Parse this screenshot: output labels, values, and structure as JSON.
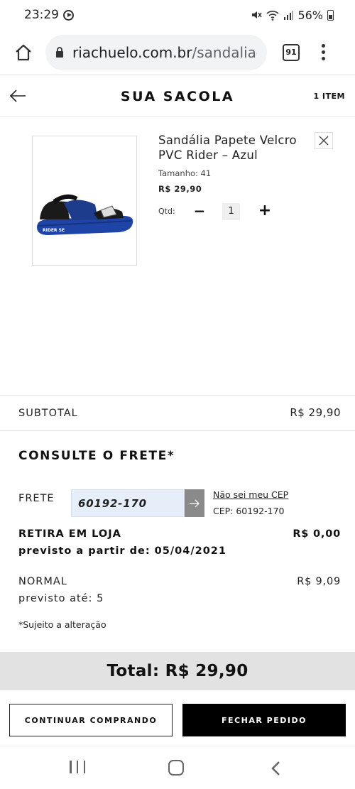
{
  "status_bar": {
    "time": "23:29",
    "battery": "56%"
  },
  "browser": {
    "domain": "riachuelo.com.br",
    "path": "/sandalia-p",
    "tab_count": "91"
  },
  "header": {
    "title": "SUA SACOLA",
    "item_count": "1 ITEM"
  },
  "product": {
    "name": "Sandália Papete Velcro PVC Rider – Azul",
    "size": "Tamanho: 41",
    "price": "R$ 29,90",
    "qty_label": "Qtd:",
    "qty_minus": "−",
    "qty_value": "1",
    "qty_plus": "+"
  },
  "subtotal": {
    "label": "SUBTOTAL",
    "value": "R$ 29,90"
  },
  "shipping": {
    "title": "CONSULTE O FRETE*",
    "label": "FRETE",
    "cep_value": "60192-170",
    "unknown_cep_link": "Não sei meu CEP",
    "cep_current": "CEP: 60192-170",
    "options": [
      {
        "name": "RETIRA EM LOJA",
        "price": "R$ 0,00",
        "date": "previsto a partir de: 05/04/2021"
      },
      {
        "name": "NORMAL",
        "price": "R$ 9,09",
        "date": "previsto até: 5"
      }
    ],
    "disclaimer": "*Sujeito a alteração"
  },
  "total": "Total: R$ 29,90",
  "actions": {
    "continue": "CONTINUAR COMPRANDO",
    "checkout": "FECHAR PEDIDO"
  },
  "product_image_text": "RIDER SE",
  "colors": {
    "accent": "#000000",
    "input_bg": "#e6eef9",
    "total_bar": "#e2e2e2"
  }
}
